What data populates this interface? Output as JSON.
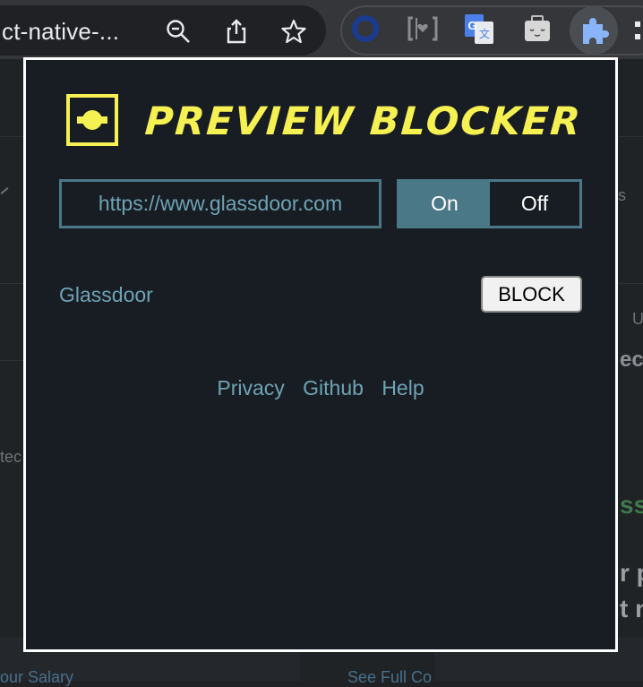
{
  "browser": {
    "omnibox_text": "ct-native-...",
    "zoom_icon": "zoom-out-icon",
    "share_icon": "share-icon",
    "bookmark_icon": "star-icon",
    "extensions": [
      "circle-extension-icon",
      "bracket-heart-extension-icon",
      "google-translate-icon",
      "sleeping-bag-extension-icon",
      "puzzle-icon",
      "more-icon"
    ]
  },
  "background_page": {
    "fragments": [
      "ec",
      "U",
      "tec",
      "ss",
      "r p",
      "t n",
      "our Salary",
      "See Full Co"
    ]
  },
  "popup": {
    "title": "PREVIEW BLOCKER",
    "url_value": "https://www.glassdoor.com",
    "toggle": {
      "on_label": "On",
      "off_label": "Off",
      "selected": "On"
    },
    "site_label": "Glassdoor",
    "block_button_label": "BLOCK",
    "footer": {
      "privacy": "Privacy",
      "github": "Github",
      "help": "Help"
    }
  },
  "colors": {
    "accent_yellow": "#f6f152",
    "teal": "#4a7886",
    "link_teal": "#6fa3b4",
    "popup_bg": "#181d24"
  }
}
